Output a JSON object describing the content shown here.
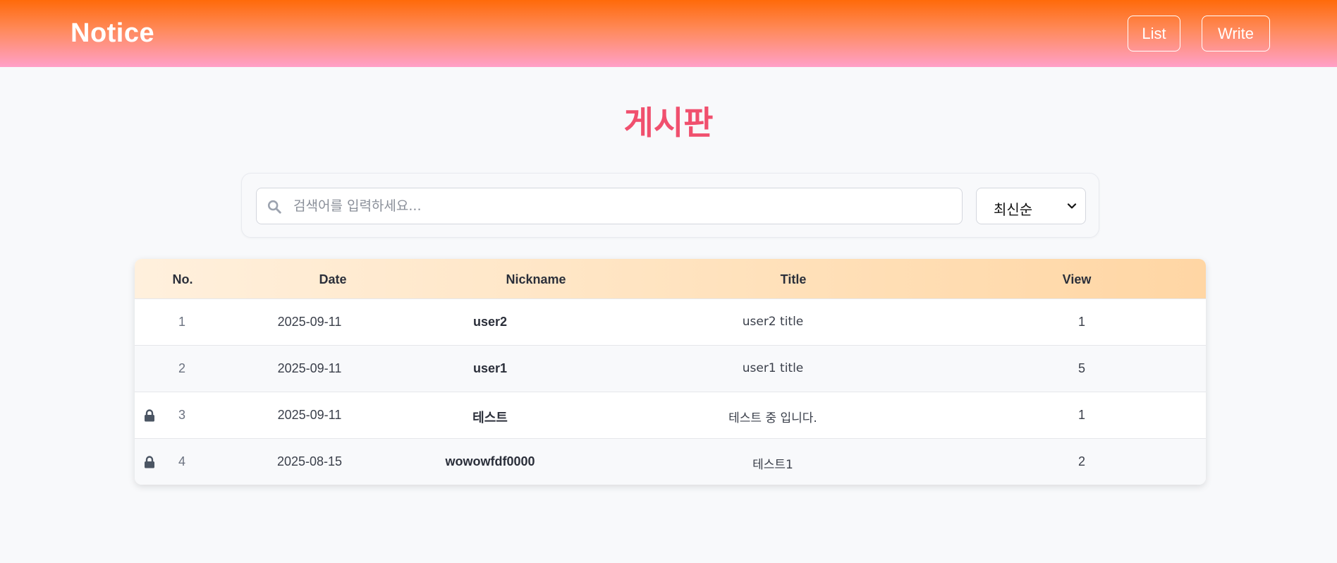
{
  "header": {
    "brand": "Notice",
    "nav": [
      {
        "label": "List"
      },
      {
        "label": "Write"
      }
    ]
  },
  "page": {
    "title": "게시판"
  },
  "search": {
    "icon": "search-icon",
    "placeholder": "검색어를 입력하세요...",
    "value": "",
    "sort": {
      "selected": "최신순",
      "icon": "chevron-down-icon"
    }
  },
  "table": {
    "headers": [
      "No.",
      "Date",
      "Nickname",
      "Title",
      "View"
    ],
    "rows": [
      {
        "no": "1",
        "date": "2025-09-11",
        "nickname": "user2",
        "title": "user2 title",
        "view": "1",
        "locked": false
      },
      {
        "no": "2",
        "date": "2025-09-11",
        "nickname": "user1",
        "title": "user1 title",
        "view": "5",
        "locked": false
      },
      {
        "no": "3",
        "date": "2025-09-11",
        "nickname": "테스트",
        "title": "테스트 중 입니다.",
        "view": "1",
        "locked": true
      },
      {
        "no": "4",
        "date": "2025-08-15",
        "nickname": "wowowfdf0000",
        "title": "테스트1",
        "view": "2",
        "locked": true
      }
    ]
  },
  "colors": {
    "title": "#f0506e",
    "header_top": "#ff6a0a",
    "header_bottom": "#ffa0c8",
    "thead_start": "#fff0dd",
    "thead_end": "#ffd6a4"
  }
}
